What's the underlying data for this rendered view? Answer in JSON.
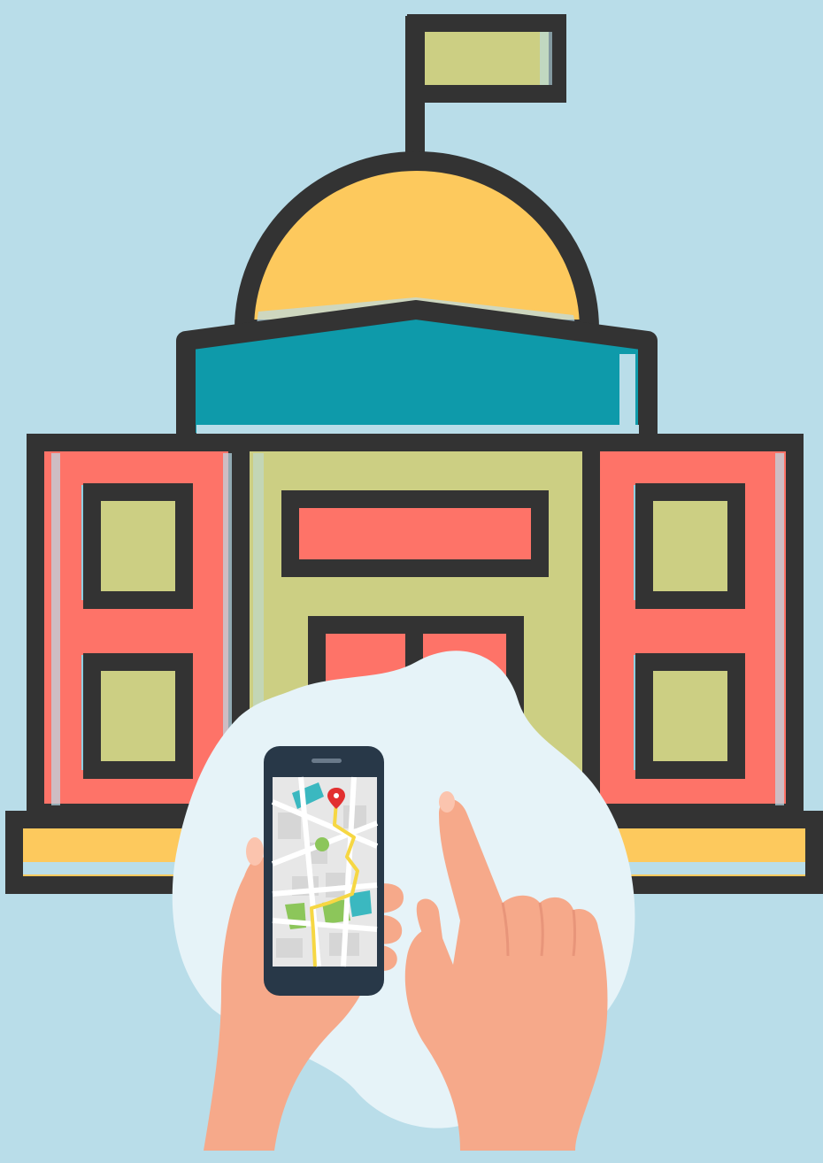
{
  "illustration": {
    "subject": "government-building-with-phone-map",
    "colors": {
      "background": "#b9dde9",
      "outline": "#333333",
      "flag": "#cccf83",
      "dome": "#fdc95d",
      "roof": "#0e9aaa",
      "wing": "#fe7368",
      "wall": "#cccf83",
      "window": "#cccf83",
      "window_shadow": "#8ecfe0",
      "base_stripe": "#fdc95d",
      "blob": "#e6f3f8",
      "skin": "#f6a98a",
      "skin_shadow": "#e8957a",
      "phone_body": "#283848",
      "map_bg": "#e7e7e7",
      "map_road": "#ffffff",
      "map_block": "#d6d6d6",
      "map_park": "#8cc65a",
      "map_water": "#3bb8c0",
      "route": "#f6d743",
      "pin": "#e23030"
    }
  }
}
